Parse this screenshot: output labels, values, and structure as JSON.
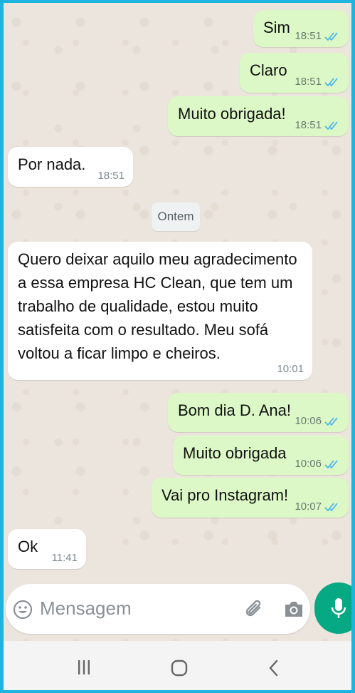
{
  "messages": [
    {
      "text": "Sim",
      "time": "18:51",
      "direction": "out",
      "status": "read"
    },
    {
      "text": "Claro",
      "time": "18:51",
      "direction": "out",
      "status": "read"
    },
    {
      "text": "Muito obrigada!",
      "time": "18:51",
      "direction": "out",
      "status": "read"
    },
    {
      "text": "Por nada.",
      "time": "18:51",
      "direction": "in"
    },
    {
      "text": "Quero deixar aquilo meu agradecimento a essa empresa HC Clean, que tem um trabalho de qualidade,  estou muito satisfeita com o resultado. Meu sofá voltou a ficar limpo e cheiros.",
      "time": "10:01",
      "direction": "in"
    },
    {
      "text": "Bom dia D. Ana!",
      "time": "10:06",
      "direction": "out",
      "status": "read"
    },
    {
      "text": "Muito obrigada",
      "time": "10:06",
      "direction": "out",
      "status": "read"
    },
    {
      "text": "Vai pro Instagram!",
      "time": "10:07",
      "direction": "out",
      "status": "read"
    },
    {
      "text": "Ok",
      "time": "11:41",
      "direction": "in"
    }
  ],
  "date_separator": "Ontem",
  "composer": {
    "placeholder": "Mensagem",
    "icons": [
      "emoji-icon",
      "paperclip-icon",
      "camera-icon",
      "microphone-icon"
    ]
  },
  "navigation": {
    "icons": [
      "recents-icon",
      "home-icon",
      "back-icon"
    ]
  },
  "colors": {
    "outgoing_bubble": "#dcf8c6",
    "incoming_bubble": "#ffffff",
    "chat_background": "#ece5dd",
    "accent_green": "#07a884",
    "read_ticks": "#4fb6ec",
    "border": "#1eb4e0"
  }
}
